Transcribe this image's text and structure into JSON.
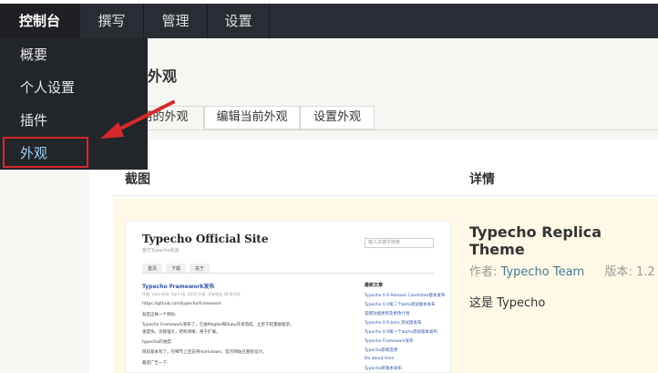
{
  "topnav": {
    "items": [
      {
        "label": "控制台"
      },
      {
        "label": "撰写"
      },
      {
        "label": "管理"
      },
      {
        "label": "设置"
      }
    ]
  },
  "dropdown": {
    "items": [
      {
        "label": "概要"
      },
      {
        "label": "个人设置"
      },
      {
        "label": "插件"
      },
      {
        "label": "外观"
      }
    ]
  },
  "page": {
    "title": "外观",
    "tabs": [
      {
        "label": "可以使用的外观"
      },
      {
        "label": "编辑当前外观"
      },
      {
        "label": "设置外观"
      }
    ]
  },
  "table": {
    "col_screenshot": "截图",
    "col_details": "详情"
  },
  "theme": {
    "name": "Typecho Replica Theme",
    "author_label": "作者:",
    "author": "Typecho Team",
    "version_label": "版本:",
    "version": "1.2",
    "description": "这是 Typecho"
  },
  "screenshot": {
    "site_title": "Typecho Official Site",
    "site_sub": "官方Typecho体验",
    "search_placeholder": "输入关键字搜索",
    "nav": [
      "首页",
      "下载",
      "关于"
    ],
    "post_title": "Typecho Framework发布",
    "post_meta": "作者: clole  时间: April 16, 2014  分类: 开发相关  48 条评论",
    "post_lines": [
      "https://github.com/typecho/framework",
      "就是这样一个目标:",
      "Typecho Framework发布了，它由Magike和Ruby开发而成，立足于轻量级框架，",
      "速度快，功能强大，结构清晰，易于扩展。",
      "typecho的进度:",
      "目前基本有了，在细节上还支持markdown，官方网站已重新设计。",
      "最后广告一下:"
    ],
    "side_heading": "最新文章",
    "side_links": [
      "Typecho 0.9 Release Candidate版本发布",
      "Typecho 0.9第二个beta测试版本发布",
      "官网功能更新及更改计划",
      "Typecho 0.9 beta 测试版发布",
      "Typecho 0.9第一个alpha测试版本发布",
      "Typecho Framework发布",
      "Typecho新闻变更",
      "Do about time",
      "Typecho新版本发布"
    ]
  },
  "colors": {
    "topbar": "#292d33",
    "accent_link": "#467b96",
    "highlight_red": "#d8282b",
    "row_highlight": "#fff8e6"
  }
}
